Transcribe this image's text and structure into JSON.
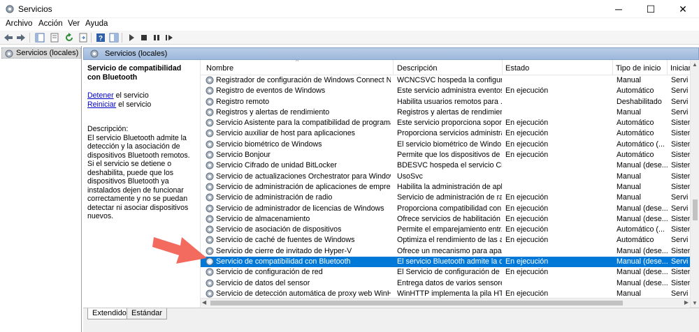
{
  "window": {
    "title": "Servicios",
    "app_icon": "gear-icon",
    "minimize": "─",
    "maximize": "☐",
    "close": "✕"
  },
  "menu": [
    "Archivo",
    "Acción",
    "Ver",
    "Ayuda"
  ],
  "toolbar": {
    "icons": [
      "back-arrow-icon",
      "forward-arrow-icon",
      "console-tree-icon",
      "properties-icon",
      "refresh-icon",
      "export-list-icon",
      "help-icon",
      "show-pane-icon",
      "play-icon",
      "stop-icon",
      "pause-icon",
      "restart-icon"
    ]
  },
  "tree": {
    "root_label": "Servicios (locales)"
  },
  "pane_header": {
    "title": "Servicios (locales)"
  },
  "extended": {
    "service_title": "Servicio de compatibilidad con Bluetooth",
    "stop_link": "Detener",
    "stop_suffix": " el servicio",
    "restart_link": "Reiniciar",
    "restart_suffix": " el servicio",
    "description_label": "Descripción:",
    "description": "El servicio Bluetooth admite la detección y la asociación de dispositivos Bluetooth remotos. Si el servicio se detiene o deshabilita, puede que los dispositivos Bluetooth ya instalados dejen de funcionar correctamente y no se puedan detectar ni asociar dispositivos nuevos."
  },
  "columns": {
    "name": "Nombre",
    "description": "Descripción",
    "state": "Estado",
    "startup_type": "Tipo de inicio",
    "login": "Iniciar"
  },
  "rows": [
    {
      "name": "Registrador de configuración de Windows Connect Now",
      "desc": "WCNCSVC hospeda la configura...",
      "state": "",
      "type": "Manual",
      "start": "Servi"
    },
    {
      "name": "Registro de eventos de Windows",
      "desc": "Este servicio administra eventos ...",
      "state": "En ejecución",
      "type": "Automático",
      "start": "Servi"
    },
    {
      "name": "Registro remoto",
      "desc": "Habilita usuarios remotos para ...",
      "state": "",
      "type": "Deshabilitado",
      "start": "Servi"
    },
    {
      "name": "Registros y alertas de rendimiento",
      "desc": "Registros y alertas de rendimient...",
      "state": "",
      "type": "Manual",
      "start": "Servi"
    },
    {
      "name": "Servicio Asistente para la compatibilidad de programas",
      "desc": "Este servicio proporciona soport...",
      "state": "En ejecución",
      "type": "Automático",
      "start": "Sisten"
    },
    {
      "name": "Servicio auxiliar de host para aplicaciones",
      "desc": "Proporciona servicios administra...",
      "state": "En ejecución",
      "type": "Automático",
      "start": "Sisten"
    },
    {
      "name": "Servicio biométrico de Windows",
      "desc": "El servicio biométrico de Windo...",
      "state": "En ejecución",
      "type": "Automático (...",
      "start": "Sisten"
    },
    {
      "name": "Servicio Bonjour",
      "desc": "Permite que los dispositivos de ...",
      "state": "En ejecución",
      "type": "Automático",
      "start": "Sisten"
    },
    {
      "name": "Servicio Cifrado de unidad BitLocker",
      "desc": "BDESVC hospeda el servicio Cifr...",
      "state": "",
      "type": "Manual (dese...",
      "start": "Sisten"
    },
    {
      "name": "Servicio de actualizaciones Orchestrator para Windows Up...",
      "desc": "UsoSvc",
      "state": "",
      "type": "Manual",
      "start": "Sisten"
    },
    {
      "name": "Servicio de administración de aplicaciones de empresa",
      "desc": "Habilita la administración de apl...",
      "state": "",
      "type": "Manual",
      "start": "Sisten"
    },
    {
      "name": "Servicio de administración de radio",
      "desc": "Servicio de administración de ra...",
      "state": "En ejecución",
      "type": "Manual",
      "start": "Servi"
    },
    {
      "name": "Servicio de administrador de licencias de Windows",
      "desc": "Proporciona compatibilidad con ...",
      "state": "En ejecución",
      "type": "Manual (dese...",
      "start": "Servi"
    },
    {
      "name": "Servicio de almacenamiento",
      "desc": "Ofrece servicios de habilitación ...",
      "state": "En ejecución",
      "type": "Manual (dese...",
      "start": "Sisten"
    },
    {
      "name": "Servicio de asociación de dispositivos",
      "desc": "Permite el emparejamiento entr...",
      "state": "En ejecución",
      "type": "Automático (...",
      "start": "Sisten"
    },
    {
      "name": "Servicio de caché de fuentes de Windows",
      "desc": "Optimiza el rendimiento de las a...",
      "state": "En ejecución",
      "type": "Automático",
      "start": "Servi"
    },
    {
      "name": "Servicio de cierre de invitado de Hyper-V",
      "desc": "Ofrece un mecanismo para apag...",
      "state": "",
      "type": "Manual (dese...",
      "start": "Sisten"
    },
    {
      "name": "Servicio de compatibilidad con Bluetooth",
      "desc": "El servicio Bluetooth admite la d...",
      "state": "En ejecución",
      "type": "Manual (dese...",
      "start": "Servi",
      "selected": true
    },
    {
      "name": "Servicio de configuración de red",
      "desc": "El Servicio de configuración de r...",
      "state": "En ejecución",
      "type": "Manual (dese...",
      "start": "Sisten"
    },
    {
      "name": "Servicio de datos del sensor",
      "desc": "Entrega datos de varios sensores",
      "state": "",
      "type": "Manual (dese...",
      "start": "Sisten"
    },
    {
      "name": "Servicio de detección automática de proxy web WinHTTP",
      "desc": "WinHTTP implementa la pila HT...",
      "state": "En ejecución",
      "type": "Manual",
      "start": "Servi"
    }
  ],
  "tabs": [
    "Extendido",
    "Estándar"
  ],
  "colors": {
    "selection": "#0078d7",
    "header": "#9db8dc",
    "annotation_arrow": "#f26b5e"
  }
}
